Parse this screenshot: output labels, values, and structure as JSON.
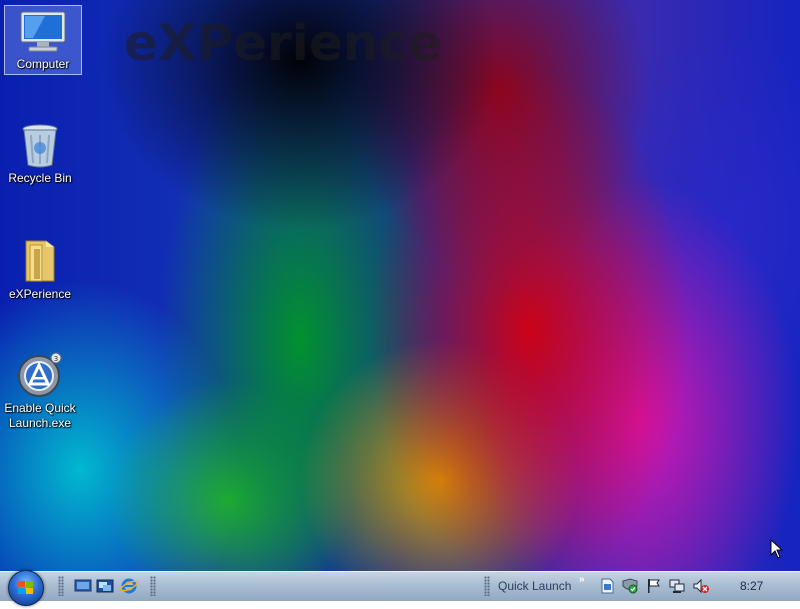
{
  "desktop": {
    "wallpaper_text": "eXPerience",
    "icons": [
      {
        "label": "Computer",
        "icon": "computer-icon",
        "selected": true
      },
      {
        "label": "Recycle Bin",
        "icon": "recycle-bin-icon"
      },
      {
        "label": "eXPerience",
        "icon": "folder-icon"
      },
      {
        "label": "Enable Quick Launch.exe",
        "icon": "app-icon"
      }
    ]
  },
  "taskbar": {
    "start_button": "start-orb-icon",
    "quick_launch_icons": [
      "show-desktop-icon",
      "switch-windows-icon",
      "internet-explorer-icon"
    ],
    "toolbar_label": "Quick Launch",
    "chevron": "»",
    "tray_icons": [
      "document-icon",
      "security-icon",
      "action-center-flag-icon",
      "network-icon",
      "volume-muted-icon"
    ],
    "clock": "8:27"
  },
  "colors": {
    "taskbar_top": "#c6d4e4",
    "taskbar_bottom": "#93a9c2",
    "start_orb": "#2a6fd6"
  }
}
